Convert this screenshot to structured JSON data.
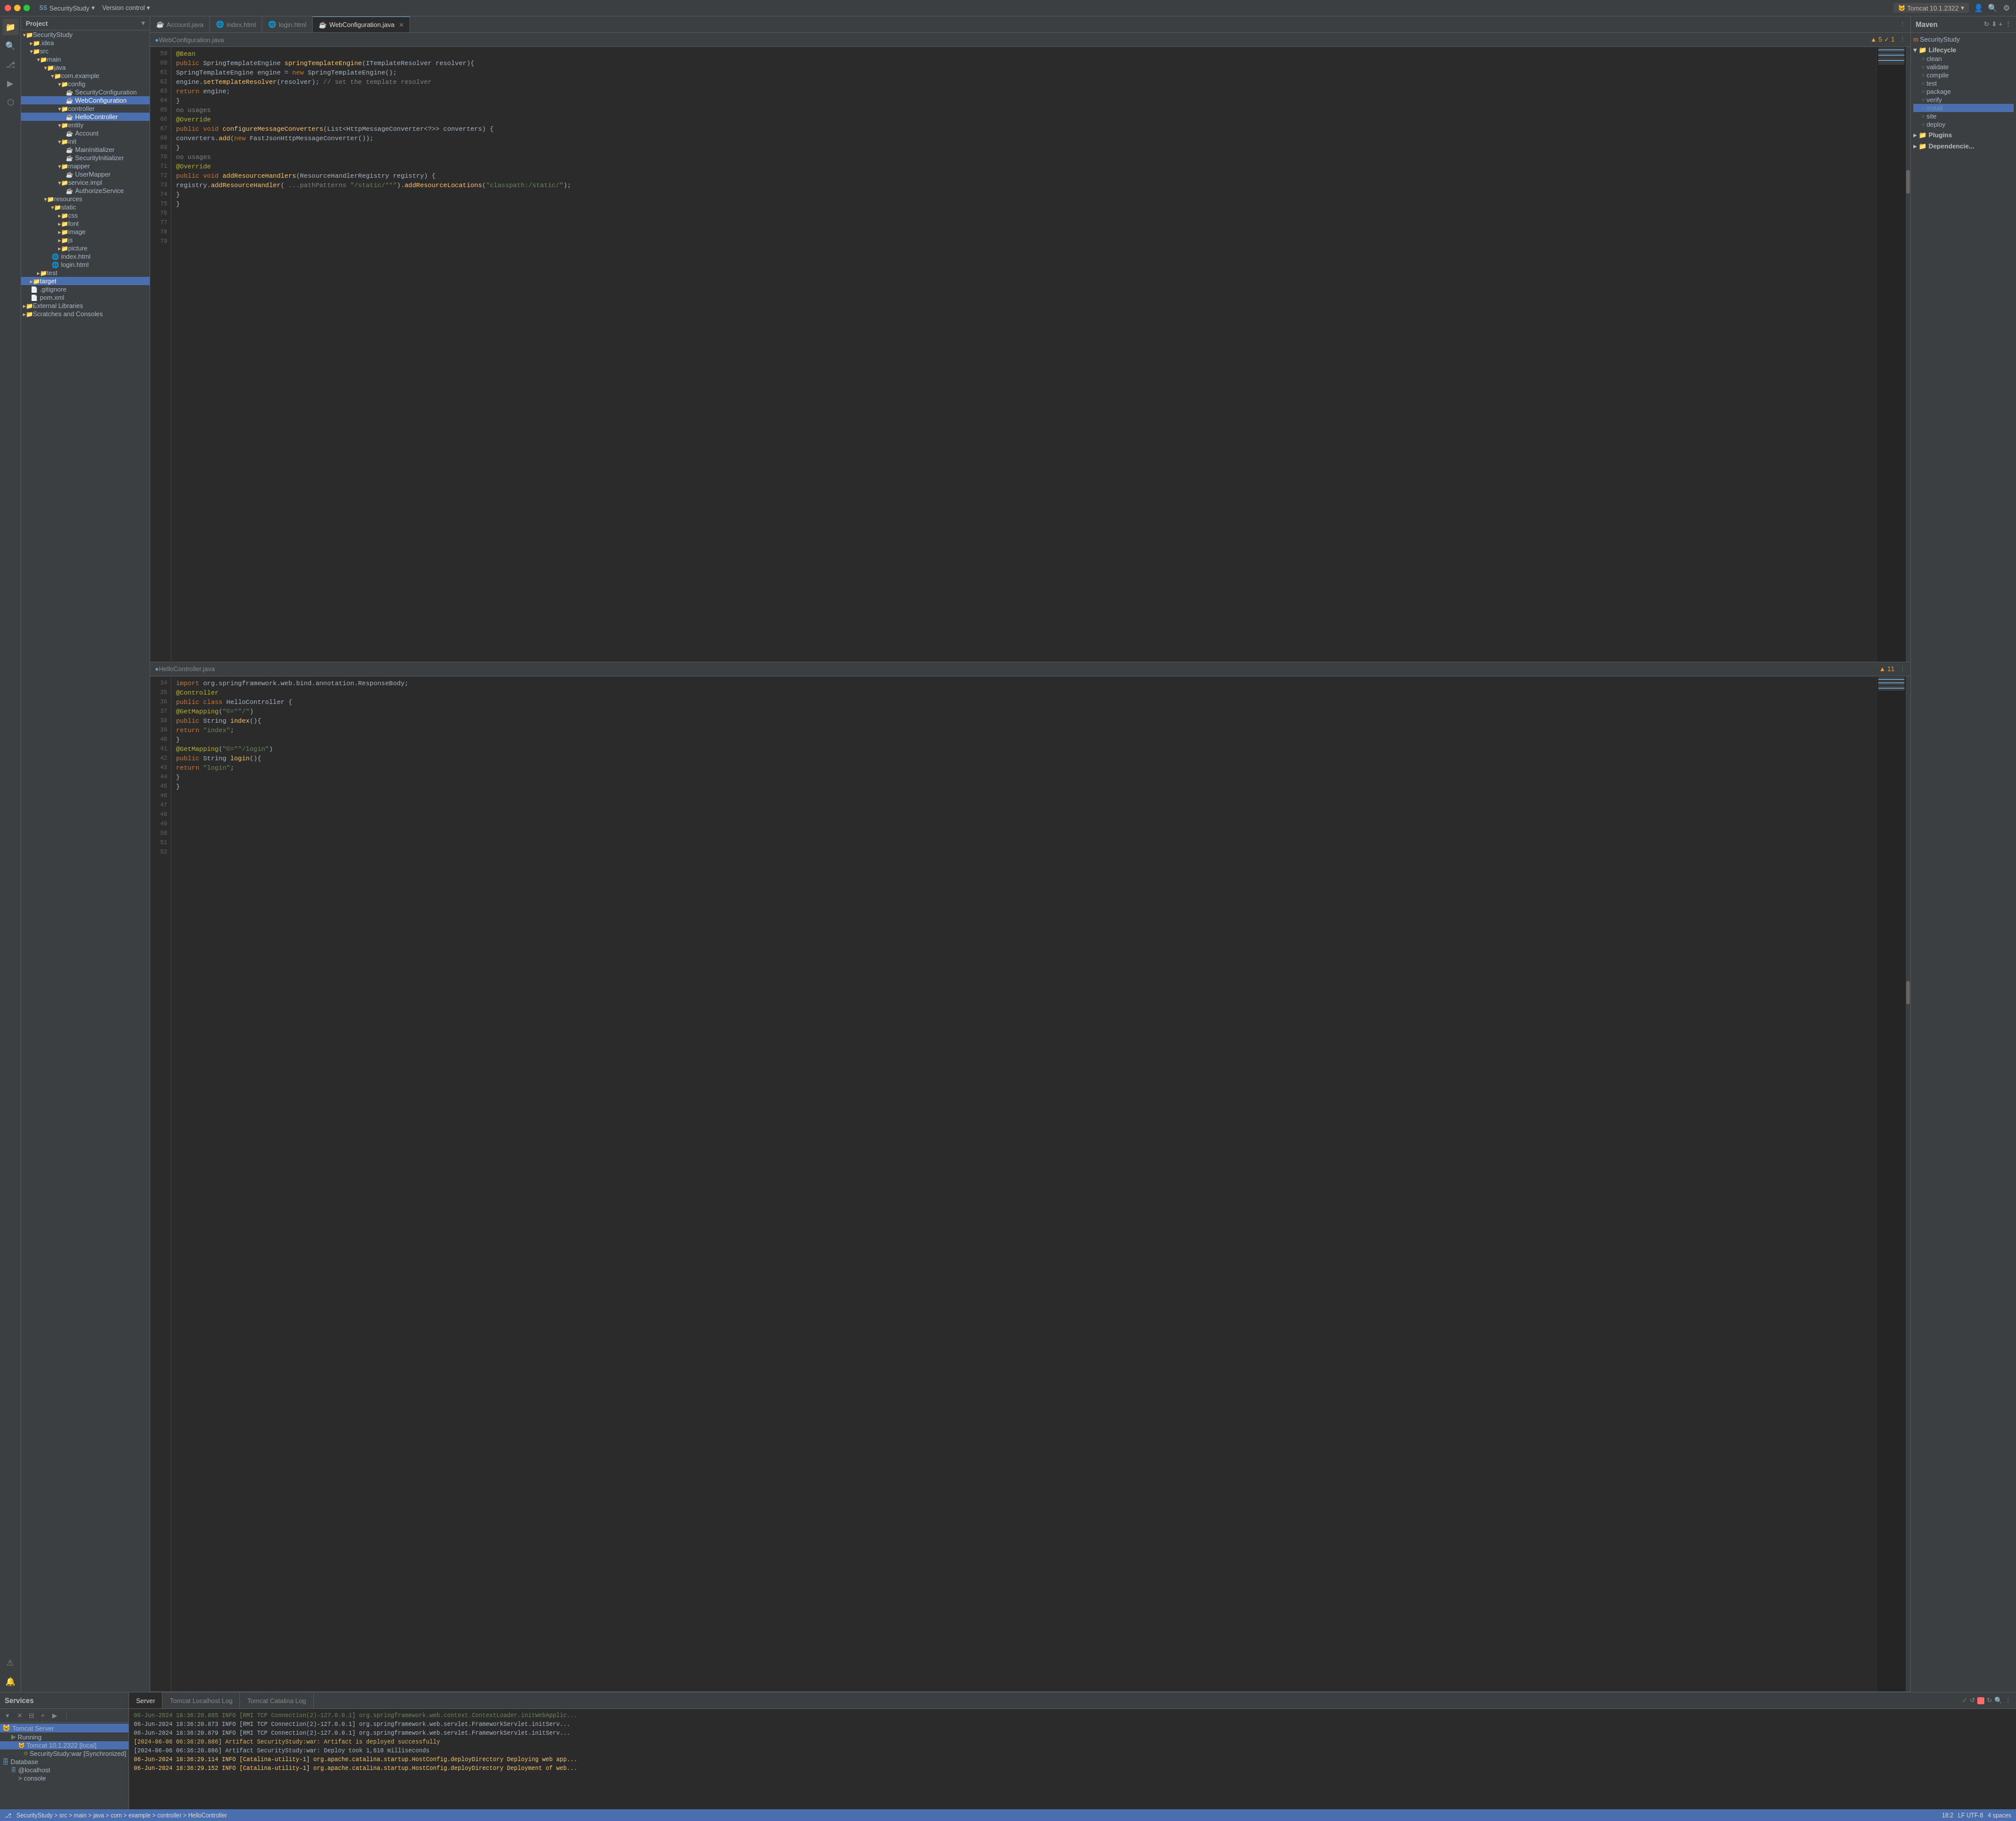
{
  "titleBar": {
    "projectName": "SecurityStudy",
    "versionControl": "Version control",
    "runConfig": "Tomcat 10.1.2322",
    "chevron": "▾"
  },
  "sidebar": {
    "header": "Project",
    "tree": [
      {
        "id": "root",
        "label": "SecurityStudy",
        "type": "root",
        "indent": 0,
        "expanded": true
      },
      {
        "id": "idea",
        "label": ".idea",
        "type": "folder",
        "indent": 1
      },
      {
        "id": "src",
        "label": "src",
        "type": "folder",
        "indent": 1,
        "expanded": true
      },
      {
        "id": "main",
        "label": "main",
        "type": "folder",
        "indent": 2,
        "expanded": true
      },
      {
        "id": "java",
        "label": "java",
        "type": "folder",
        "indent": 3,
        "expanded": true
      },
      {
        "id": "comexample",
        "label": "com.example",
        "type": "folder",
        "indent": 4,
        "expanded": true
      },
      {
        "id": "config",
        "label": "config",
        "type": "folder",
        "indent": 5,
        "expanded": true
      },
      {
        "id": "SecurityConfiguration",
        "label": "SecurityConfiguration",
        "type": "java",
        "indent": 6
      },
      {
        "id": "WebConfiguration",
        "label": "WebConfiguration",
        "type": "java",
        "indent": 6,
        "selected": true
      },
      {
        "id": "controller",
        "label": "controller",
        "type": "folder",
        "indent": 5,
        "expanded": true
      },
      {
        "id": "HelloController",
        "label": "HelloController",
        "type": "java",
        "indent": 6,
        "selected": true
      },
      {
        "id": "entity",
        "label": "entity",
        "type": "folder",
        "indent": 5,
        "expanded": true
      },
      {
        "id": "Account",
        "label": "Account",
        "type": "java",
        "indent": 6
      },
      {
        "id": "init",
        "label": "init",
        "type": "folder",
        "indent": 5,
        "expanded": true
      },
      {
        "id": "MainInitializer",
        "label": "MainInitializer",
        "type": "java",
        "indent": 6
      },
      {
        "id": "SecurityInitializer",
        "label": "SecurityInitializer",
        "type": "java",
        "indent": 6
      },
      {
        "id": "mapper",
        "label": "mapper",
        "type": "folder",
        "indent": 5,
        "expanded": true
      },
      {
        "id": "UserMapper",
        "label": "UserMapper",
        "type": "java",
        "indent": 6
      },
      {
        "id": "serviceimpl",
        "label": "service.impl",
        "type": "folder",
        "indent": 5,
        "expanded": true
      },
      {
        "id": "AuthorizeService",
        "label": "AuthorizeService",
        "type": "java",
        "indent": 6
      },
      {
        "id": "resources",
        "label": "resources",
        "type": "folder",
        "indent": 3,
        "expanded": true
      },
      {
        "id": "static",
        "label": "static",
        "type": "folder",
        "indent": 4,
        "expanded": true
      },
      {
        "id": "css",
        "label": "css",
        "type": "folder",
        "indent": 5
      },
      {
        "id": "font",
        "label": "font",
        "type": "folder",
        "indent": 5
      },
      {
        "id": "image",
        "label": "image",
        "type": "folder",
        "indent": 5
      },
      {
        "id": "js",
        "label": "js",
        "type": "folder",
        "indent": 5
      },
      {
        "id": "picture",
        "label": "picture",
        "type": "folder",
        "indent": 5
      },
      {
        "id": "indexhtml",
        "label": "index.html",
        "type": "html",
        "indent": 4
      },
      {
        "id": "loginhtml",
        "label": "login.html",
        "type": "html",
        "indent": 4
      },
      {
        "id": "test",
        "label": "test",
        "type": "folder",
        "indent": 2
      },
      {
        "id": "target",
        "label": "target",
        "type": "folder",
        "indent": 1,
        "selected": true
      },
      {
        "id": "gitignore",
        "label": ".gitignore",
        "type": "file",
        "indent": 1
      },
      {
        "id": "pomxml",
        "label": "pom.xml",
        "type": "xml",
        "indent": 1
      },
      {
        "id": "ExternalLibraries",
        "label": "External Libraries",
        "type": "folder",
        "indent": 0
      },
      {
        "id": "ScratchesConsoles",
        "label": "Scratches and Consoles",
        "type": "folder",
        "indent": 0
      }
    ]
  },
  "tabs": {
    "items": [
      {
        "id": "account",
        "label": "Account.java",
        "active": false,
        "modified": false
      },
      {
        "id": "index",
        "label": "index.html",
        "active": false,
        "modified": false
      },
      {
        "id": "login",
        "label": "login.html",
        "active": false,
        "modified": false
      },
      {
        "id": "webconfig",
        "label": "WebConfiguration.java",
        "active": true,
        "modified": false
      }
    ]
  },
  "webConfigEditor": {
    "filename": "WebConfiguration.java",
    "lines": [
      {
        "num": 59,
        "code": "    @Bean"
      },
      {
        "num": 60,
        "code": "    public SpringTemplateEngine springTemplateEngine(ITemplateResolver resolver){"
      },
      {
        "num": 61,
        "code": "        SpringTemplateEngine engine = new SpringTemplateEngine();"
      },
      {
        "num": 62,
        "code": "        engine.setTemplateResolver(resolver); // set the template resolver"
      },
      {
        "num": 63,
        "code": "        return engine;"
      },
      {
        "num": 64,
        "code": "    }"
      },
      {
        "num": 65,
        "code": ""
      },
      {
        "num": 66,
        "code": "    @Override"
      },
      {
        "num": 67,
        "code": "    public void configureMessageConverters(List<HttpMessageConverter<?>> converters) {"
      },
      {
        "num": 68,
        "code": "        converters.add(new FastJsonHttpMessageConverter());"
      },
      {
        "num": 69,
        "code": "    }"
      },
      {
        "num": 70,
        "code": ""
      },
      {
        "num": 71,
        "code": "    @Override"
      },
      {
        "num": 72,
        "code": "    public void addResourceHandlers(ResourceHandlerRegistry registry) {"
      },
      {
        "num": 73,
        "code": "        registry.addResourceHandler( ...pathPatterns  \"/static/**\").addResourceLocations(\"classpath:/static/\");"
      },
      {
        "num": 74,
        "code": "    }"
      },
      {
        "num": 75,
        "code": ""
      },
      {
        "num": 76,
        "code": ""
      },
      {
        "num": 77,
        "code": ""
      },
      {
        "num": 78,
        "code": "    }"
      },
      {
        "num": 79,
        "code": ""
      }
    ],
    "warnings": "▲ 5  ✓ 1"
  },
  "helloControllerEditor": {
    "filename": "HelloController.java",
    "lines": [
      {
        "num": 34,
        "code": "import org.springframework.web.bind.annotation.ResponseBody;"
      },
      {
        "num": 35,
        "code": ""
      },
      {
        "num": 36,
        "code": "@Controller"
      },
      {
        "num": 37,
        "code": "public class HelloController {"
      },
      {
        "num": 38,
        "code": ""
      },
      {
        "num": 39,
        "code": ""
      },
      {
        "num": 40,
        "code": ""
      },
      {
        "num": 41,
        "code": "    @GetMapping(\"©=\"/\")"
      },
      {
        "num": 42,
        "code": "    public String index(){"
      },
      {
        "num": 43,
        "code": "        return \"index\";"
      },
      {
        "num": 44,
        "code": "    }"
      },
      {
        "num": 45,
        "code": ""
      },
      {
        "num": 46,
        "code": ""
      },
      {
        "num": 47,
        "code": "    @GetMapping(\"©=\"/login\")"
      },
      {
        "num": 48,
        "code": "    public String login(){"
      },
      {
        "num": 49,
        "code": "        return \"login\";"
      },
      {
        "num": 50,
        "code": "    }"
      },
      {
        "num": 51,
        "code": ""
      },
      {
        "num": 52,
        "code": "    }"
      }
    ],
    "warnings": "▲ 11"
  },
  "maven": {
    "header": "Maven",
    "tree": {
      "root": "SecurityStudy",
      "lifecycle": {
        "label": "Lifecycle",
        "items": [
          "clean",
          "validate",
          "compile",
          "test",
          "package",
          "verify",
          "install",
          "site",
          "deploy"
        ]
      },
      "plugins": "Plugins",
      "dependencies": "Dependencie..."
    }
  },
  "services": {
    "header": "Services",
    "tomcat": {
      "label": "Tomcat Server",
      "running": "Running",
      "instance": "Tomcat 10.1.2322 [local]",
      "war": "SecurityStudy:war [Synchronized]"
    },
    "database": {
      "label": "Database",
      "host": "@localhost",
      "console": "console"
    }
  },
  "consoleTabs": {
    "items": [
      "Server",
      "Tomcat Localhost Log",
      "Tomcat Catalina Log"
    ]
  },
  "consoleLog": {
    "lines": [
      {
        "type": "success",
        "text": "06-Jun-2024 18:36:20.865 INFO [RMI TCP Connection(2)-127.0.0.1] org.springframework.web.context.ContextLoader.initWebApplic..."
      },
      {
        "type": "info",
        "text": "06-Jun-2024 18:36:20.873 INFO [RMI TCP Connection(2)-127.0.0.1] org.springframework.web.servlet.FrameworkServlet.initServ..."
      },
      {
        "type": "info",
        "text": "06-Jun-2024 18:36:20.879 INFO [RMI TCP Connection(2)-127.0.0.1] org.springframework.web.servlet.FrameworkServlet.initServ..."
      },
      {
        "type": "warn",
        "text": "[2024-06-06 06:36:20.886] Artifact SecurityStudy:war: Artifact is deployed successfully"
      },
      {
        "type": "info",
        "text": "[2024-06-06 06:36:20.886] Artifact SecurityStudy:war: Deploy took 1,610 milliseconds"
      },
      {
        "type": "highlight",
        "text": "06-Jun-2024 18:36:29.114 INFO [Catalina-utility-1] org.apache.catalina.startup.HostConfig.deployDirectory Deploying web app..."
      },
      {
        "type": "highlight",
        "text": "06-Jun-2024 18:36:29.152 INFO [Catalina-utility-1] org.apache.catalina.startup.HostConfig.deployDirectory Deployment of web..."
      }
    ]
  },
  "statusBar": {
    "breadcrumb": "SecurityStudy > src > main > java > com > example > controller > HelloController",
    "position": "18:2",
    "encoding": "LF  UTF-8",
    "indent": "4 spaces"
  }
}
